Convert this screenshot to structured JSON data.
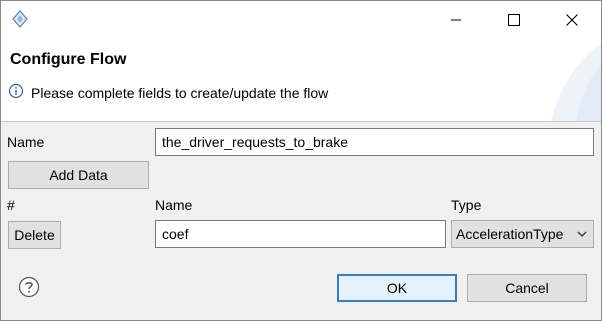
{
  "window": {
    "app_icon": "diamond-app-icon",
    "controls": {
      "minimize": "minimize-icon",
      "maximize": "maximize-icon",
      "close": "close-icon"
    }
  },
  "header": {
    "title": "Configure Flow",
    "message": "Please complete fields to create/update the flow",
    "message_icon": "info-icon"
  },
  "form": {
    "name_label": "Name",
    "name_value": "the_driver_requests_to_brake",
    "add_data_label": "Add Data",
    "columns": {
      "index": "#",
      "name": "Name",
      "type": "Type"
    },
    "rows": [
      {
        "delete_label": "Delete",
        "name": "coef",
        "type": "AccelerationType"
      }
    ]
  },
  "footer": {
    "help_icon": "help-icon",
    "ok_label": "OK",
    "cancel_label": "Cancel"
  },
  "colors": {
    "accent": "#3c7fb1",
    "window_bg": "#f0f0f0",
    "banner_bg": "#ffffff"
  }
}
